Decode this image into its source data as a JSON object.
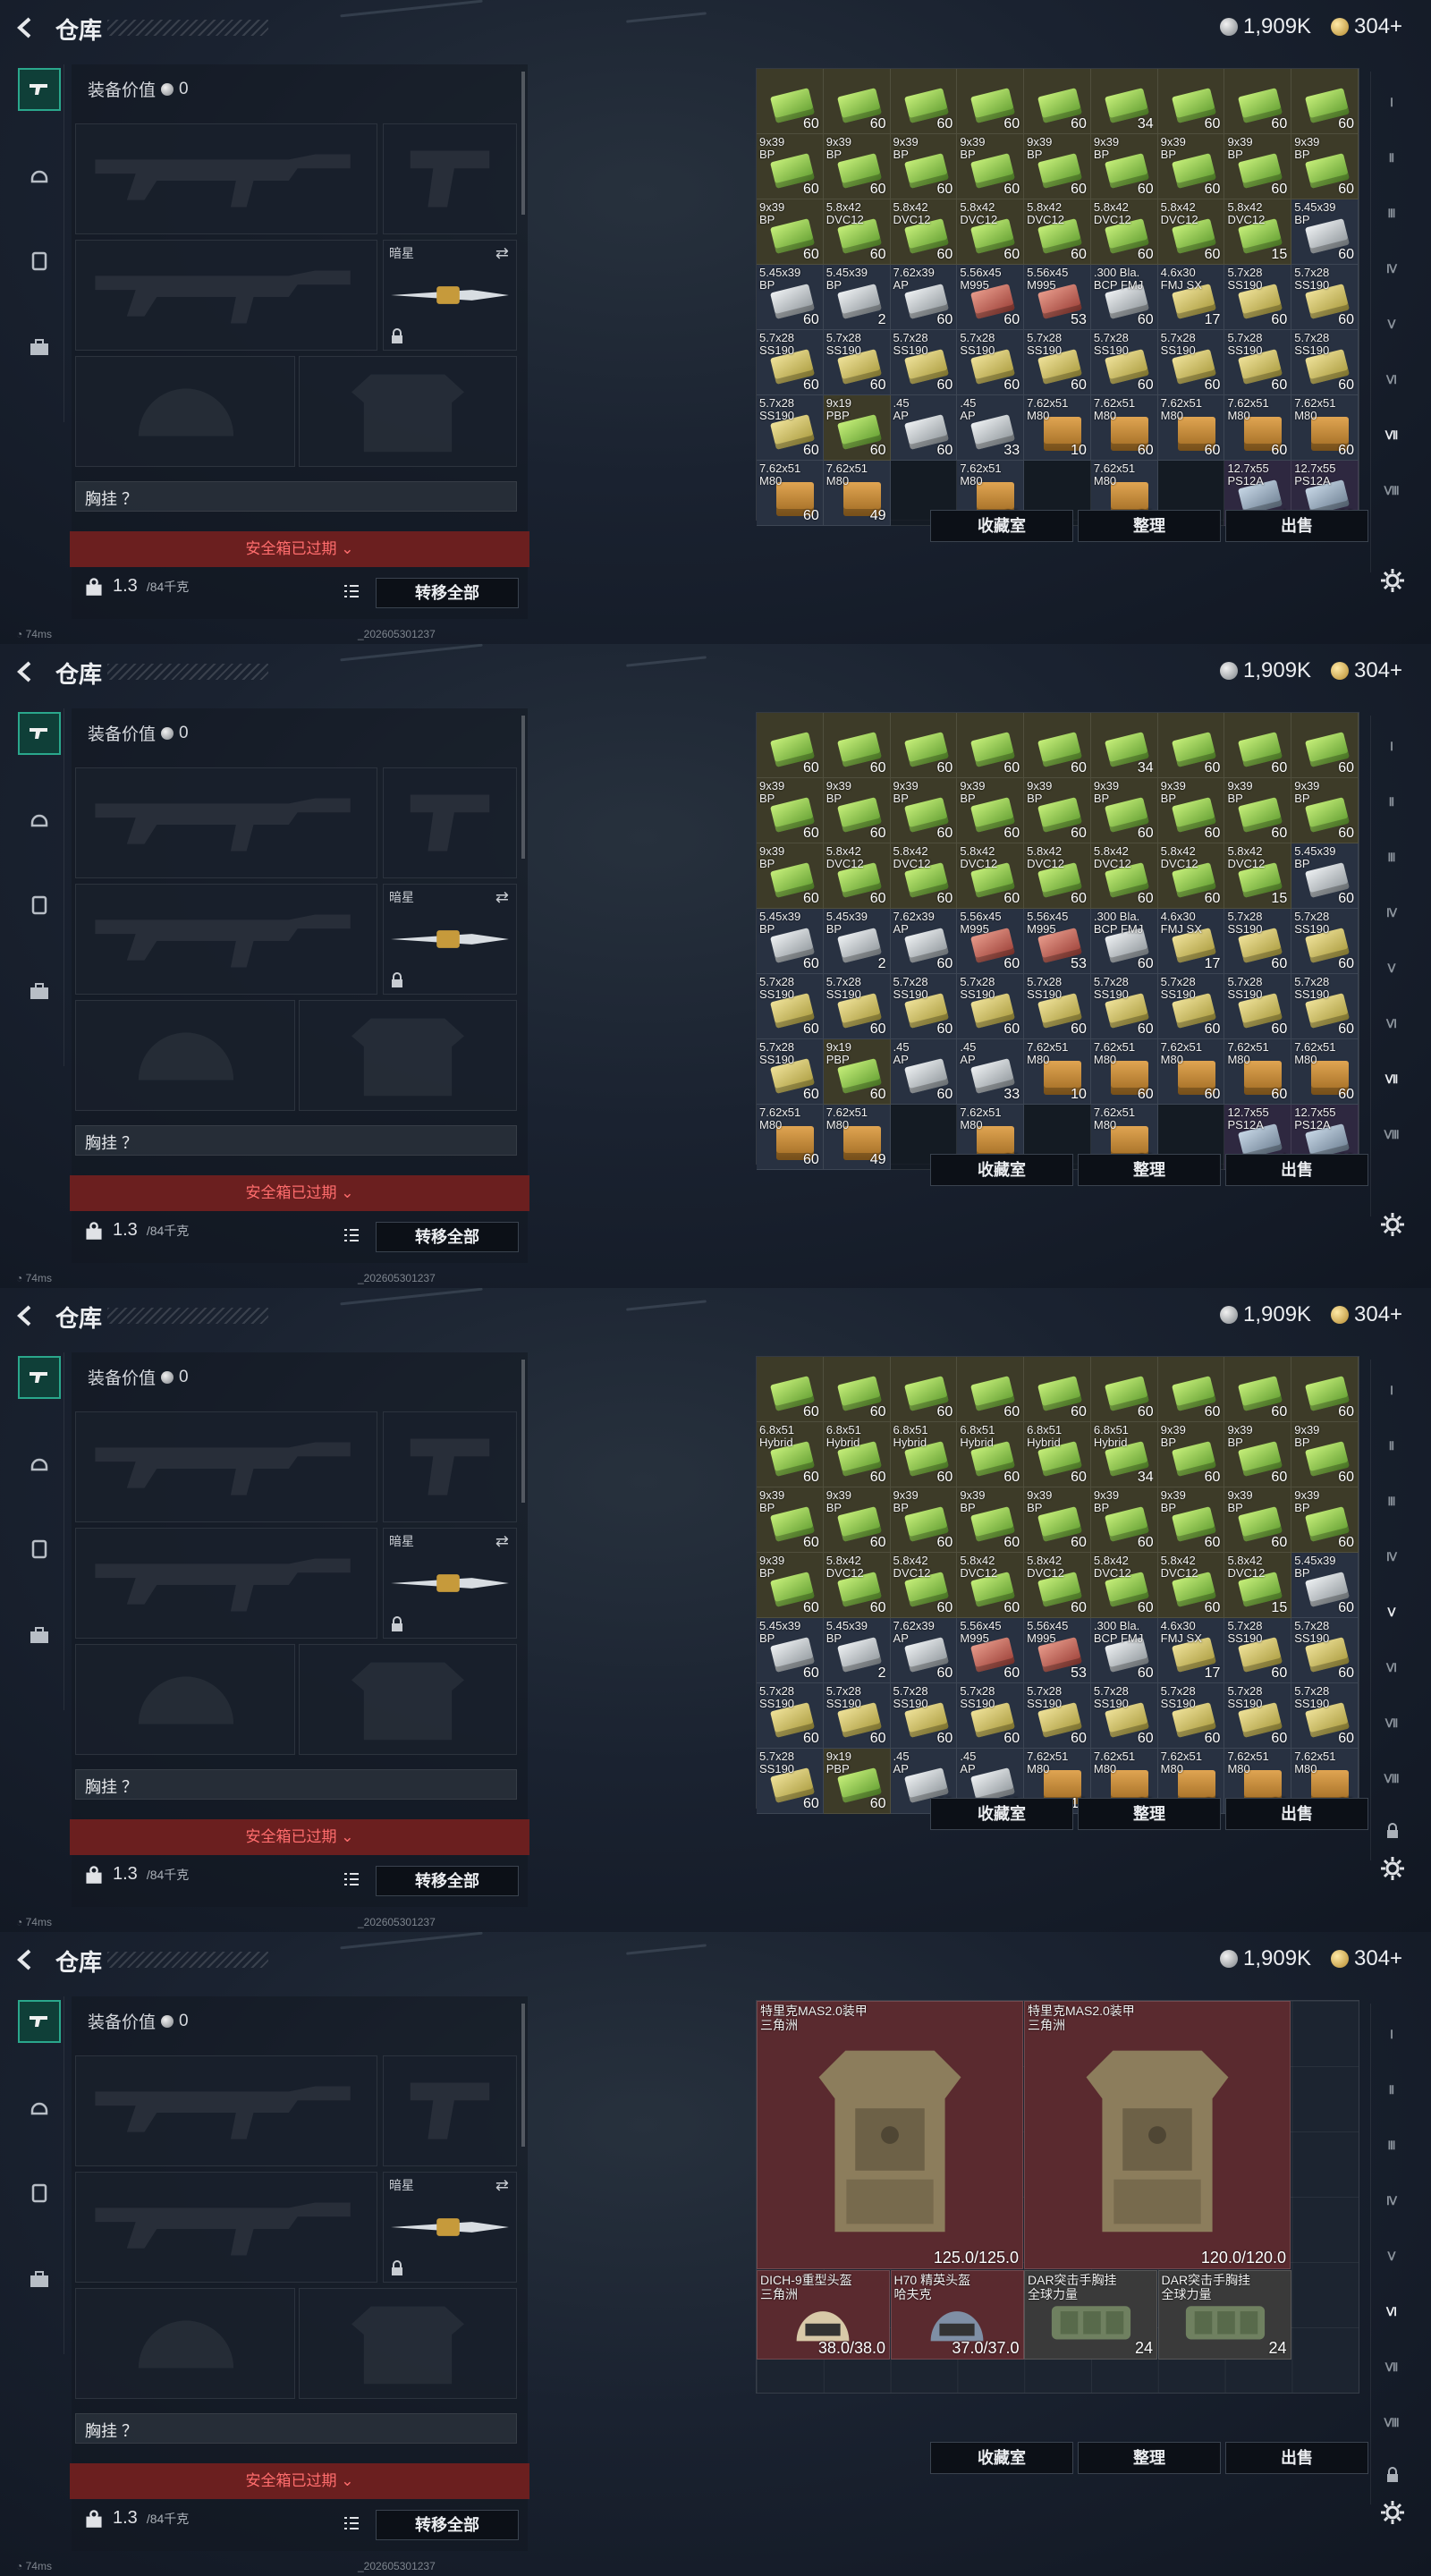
{
  "header": {
    "title": "仓库",
    "silver": "1,909K",
    "gold": "304+"
  },
  "equipment": {
    "value_label": "装备价值",
    "value": "0",
    "melee_label": "暗星",
    "chest_label": "胸挂 ？",
    "safe_expired": "安全箱已过期",
    "weight_value": "1.3",
    "weight_cap": "/84千克",
    "transfer_all": "转移全部"
  },
  "actions": {
    "collection": "收藏室",
    "sort": "整理",
    "sell": "出售"
  },
  "footer": {
    "ping": "74ms",
    "build": "_202605301237"
  },
  "right_nav": [
    "Ⅰ",
    "Ⅱ",
    "Ⅲ",
    "Ⅳ",
    "Ⅴ",
    "Ⅵ",
    "Ⅶ",
    "Ⅷ"
  ],
  "frames": [
    {
      "selected_tab": 6,
      "rows": [
        [
          [
            "",
            "60",
            "green"
          ],
          [
            "",
            "60",
            "green"
          ],
          [
            "",
            "60",
            "green"
          ],
          [
            "",
            "60",
            "green"
          ],
          [
            "",
            "60",
            "green"
          ],
          [
            "",
            "34",
            "green"
          ],
          [
            "",
            "60",
            "green"
          ],
          [
            "",
            "60",
            "green"
          ],
          [
            "",
            "60",
            "green"
          ]
        ],
        [
          [
            "9x39\nBP",
            "60",
            "green"
          ],
          [
            "9x39\nBP",
            "60",
            "green"
          ],
          [
            "9x39\nBP",
            "60",
            "green"
          ],
          [
            "9x39\nBP",
            "60",
            "green"
          ],
          [
            "9x39\nBP",
            "60",
            "green"
          ],
          [
            "9x39\nBP",
            "60",
            "green"
          ],
          [
            "9x39\nBP",
            "60",
            "green"
          ],
          [
            "9x39\nBP",
            "60",
            "green"
          ],
          [
            "9x39\nBP",
            "60",
            "green"
          ]
        ],
        [
          [
            "9x39\nBP",
            "60",
            "green"
          ],
          [
            "5.8x42\nDVC12",
            "60",
            "green"
          ],
          [
            "5.8x42\nDVC12",
            "60",
            "green"
          ],
          [
            "5.8x42\nDVC12",
            "60",
            "green"
          ],
          [
            "5.8x42\nDVC12",
            "60",
            "green"
          ],
          [
            "5.8x42\nDVC12",
            "60",
            "green"
          ],
          [
            "5.8x42\nDVC12",
            "60",
            "green"
          ],
          [
            "5.8x42\nDVC12",
            "15",
            "green"
          ],
          [
            "5.45x39\nBP",
            "60",
            "gray"
          ]
        ],
        [
          [
            "5.45x39\nBP",
            "60",
            "gray"
          ],
          [
            "5.45x39\nBP",
            "2",
            "gray"
          ],
          [
            "7.62x39\nAP",
            "60",
            "gray"
          ],
          [
            "5.56x45\nM995",
            "60",
            "red"
          ],
          [
            "5.56x45\nM995",
            "53",
            "red"
          ],
          [
            ".300 Bla.\nBCP FMJ",
            "60",
            "gray"
          ],
          [
            "4.6x30\nFMJ SX",
            "17",
            "yellow"
          ],
          [
            "5.7x28\nSS190",
            "60",
            "yellow"
          ],
          [
            "5.7x28\nSS190",
            "60",
            "yellow"
          ]
        ],
        [
          [
            "5.7x28\nSS190",
            "60",
            "yellow"
          ],
          [
            "5.7x28\nSS190",
            "60",
            "yellow"
          ],
          [
            "5.7x28\nSS190",
            "60",
            "yellow"
          ],
          [
            "5.7x28\nSS190",
            "60",
            "yellow"
          ],
          [
            "5.7x28\nSS190",
            "60",
            "yellow"
          ],
          [
            "5.7x28\nSS190",
            "60",
            "yellow"
          ],
          [
            "5.7x28\nSS190",
            "60",
            "yellow"
          ],
          [
            "5.7x28\nSS190",
            "60",
            "yellow"
          ],
          [
            "5.7x28\nSS190",
            "60",
            "yellow"
          ]
        ],
        [
          [
            "5.7x28\nSS190",
            "60",
            "yellow"
          ],
          [
            "9x19\nPBP",
            "60",
            "green"
          ],
          [
            ".45\nAP",
            "60",
            "gray"
          ],
          [
            ".45\nAP",
            "33",
            "gray"
          ],
          [
            "7.62x51\nM80",
            "10",
            "crate"
          ],
          [
            "7.62x51\nM80",
            "60",
            "crate"
          ],
          [
            "7.62x51\nM80",
            "60",
            "crate"
          ],
          [
            "7.62x51\nM80",
            "60",
            "crate"
          ],
          [
            "7.62x51\nM80",
            "60",
            "crate"
          ]
        ],
        [
          [
            "7.62x51\nM80",
            "60",
            "crate"
          ],
          [
            "7.62x51\nM80",
            "49",
            "crate"
          ],
          [
            "",
            "",
            ""
          ],
          [
            "7.62x51\nM80",
            "60",
            "crate"
          ],
          [
            "",
            "",
            ""
          ],
          [
            "7.62x51\nM80",
            "60",
            "crate"
          ],
          [
            "",
            "",
            ""
          ],
          [
            "12.7x55\nPS12A",
            "4",
            "blue"
          ],
          [
            "12.7x55\nPS12A",
            "60",
            "blue"
          ]
        ]
      ]
    },
    {
      "selected_tab": 6,
      "same_as": 0
    },
    {
      "selected_tab": 4,
      "first_row": [
        [
          "",
          "60",
          "green"
        ],
        [
          "",
          "60",
          "green"
        ],
        [
          "",
          "60",
          "green"
        ],
        [
          "",
          "60",
          "green"
        ],
        [
          "",
          "60",
          "green"
        ],
        [
          "",
          "60",
          "green"
        ],
        [
          "",
          "60",
          "green"
        ],
        [
          "",
          "60",
          "green"
        ],
        [
          "",
          "60",
          "green"
        ]
      ],
      "second_row": [
        [
          "6.8x51\nHybrid",
          "60",
          "green"
        ],
        [
          "6.8x51\nHybrid",
          "60",
          "green"
        ],
        [
          "6.8x51\nHybrid",
          "60",
          "green"
        ],
        [
          "6.8x51\nHybrid",
          "60",
          "green"
        ],
        [
          "6.8x51\nHybrid",
          "60",
          "green"
        ],
        [
          "6.8x51\nHybrid",
          "34",
          "green"
        ],
        [
          "9x39\nBP",
          "60",
          "green"
        ],
        [
          "9x39\nBP",
          "60",
          "green"
        ],
        [
          "9x39\nBP",
          "60",
          "green"
        ]
      ]
    },
    {
      "selected_tab": 5,
      "armor": [
        {
          "name": "特里克MAS2.0装甲\n三角洲",
          "dur": "125.0/125.0"
        },
        {
          "name": "特里克MAS2.0装甲\n三角洲",
          "dur": "120.0/120.0"
        }
      ],
      "small": [
        {
          "name": "DICH-9重型头盔\n三角洲",
          "dur": "38.0/38.0"
        },
        {
          "name": "H70 精英头盔\n哈夫克",
          "dur": "37.0/37.0"
        },
        {
          "name": "DAR突击手胸挂\n全球力量",
          "dur": "24"
        },
        {
          "name": "DAR突击手胸挂\n全球力量",
          "dur": "24"
        }
      ]
    }
  ],
  "colors": {
    "accent": "#2aa78c",
    "danger": "#6b1f1f",
    "armor_bg": "#5a2a2f"
  }
}
